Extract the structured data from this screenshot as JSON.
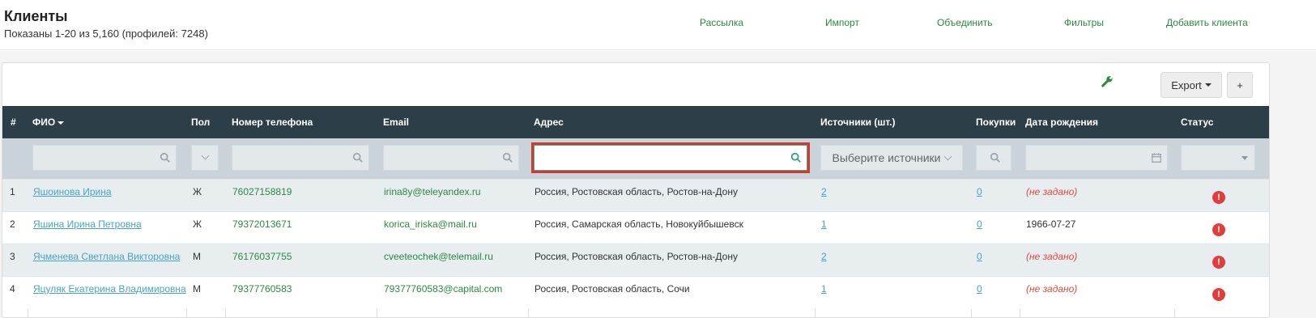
{
  "header": {
    "title": "Клиенты",
    "subtitle": "Показаны 1-20 из 5,160 (профилей: 7248)",
    "nav": [
      "Рассылка",
      "Импорт",
      "Объединить",
      "Фильтры",
      "Добавить клиента"
    ]
  },
  "toolbar": {
    "export_label": "Export",
    "plus_label": "+"
  },
  "table": {
    "columns": [
      "#",
      "ФИО",
      "Пол",
      "Номер телефона",
      "Email",
      "Адрес",
      "Источники (шт.)",
      "Покупки",
      "Дата рождения",
      "Статус"
    ],
    "filters": {
      "address_value": "",
      "sources_placeholder": "Выберите источники"
    },
    "rows": [
      {
        "num": "1",
        "name": "Яшоинова Ирина",
        "gender": "Ж",
        "phone": "76027158819",
        "email": "irina8y@teleyandex.ru",
        "address": "Россия, Ростовская область, Ростов-на-Дону",
        "sources": "2",
        "purchases": "0",
        "birth": "(не задано)"
      },
      {
        "num": "2",
        "name": "Яшина Ирина Петровна",
        "gender": "Ж",
        "phone": "79372013671",
        "email": "korica_iriska@mail.ru",
        "address": "Россия, Самарская область, Новокуйбышевск",
        "sources": "1",
        "purchases": "0",
        "birth": "1966-07-27"
      },
      {
        "num": "3",
        "name": "Ячменева Светлана Викторовна",
        "gender": "М",
        "phone": "76176037755",
        "email": "cveeteochek@telemail.ru",
        "address": "Россия, Ростовская область, Ростов-на-Дону",
        "sources": "2",
        "purchases": "0",
        "birth": "(не задано)"
      },
      {
        "num": "4",
        "name": "Яцуляк Екатерина Владимировна",
        "gender": "М",
        "phone": "79377760583",
        "email": "79377760583@capital.com",
        "address": "Россия, Ростовская область, Сочи",
        "sources": "1",
        "purchases": "0",
        "birth": "(не задано)"
      }
    ]
  },
  "colors": {
    "accent_green": "#2a8a3e",
    "header_bg": "#2c3e48",
    "link_blue": "#46a4c7",
    "highlight_red": "#d9352b",
    "status_red": "#e23d3d"
  }
}
